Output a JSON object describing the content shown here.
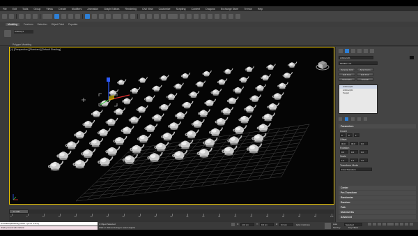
{
  "menubar": {
    "items": [
      "File",
      "Edit",
      "Tools",
      "Group",
      "Views",
      "Create",
      "Modifiers",
      "Animation",
      "Graph Editors",
      "Rendering",
      "Civil View",
      "Customize",
      "Scripting",
      "Content",
      "Dragons",
      "Exchange Store",
      "Tremor",
      "Help"
    ]
  },
  "ribbon": {
    "tabs": [
      "Modeling",
      "Freeform",
      "Selection",
      "Object Paint",
      "Populate"
    ],
    "active_tab": "Modeling",
    "panel_label": "Polygon Modeling",
    "object_name": "Arbitrary1"
  },
  "viewport": {
    "label": "[+] [Perspective] [Standard] [Default Shading]",
    "teapot_rows": 9,
    "teapot_cols": 9
  },
  "command_panel": {
    "object_name": "Arbitrary01",
    "modifier_list": "Modifier List",
    "buttons": [
      "Arrange Grid",
      "Array Form",
      "Edit Poly",
      "Edit Poly",
      "Symmetry",
      "Smooth"
    ],
    "stack": [
      "Arbitrary01",
      "Arbitrary01",
      "Teapot"
    ],
    "section_title": "Parameters",
    "count_label": "Count",
    "count_values": [
      "9",
      "9",
      "1"
    ],
    "offset_label": "Offset",
    "offset_values": [
      "30.0",
      "30.0",
      "0.0"
    ],
    "rotation_label": "Rotation",
    "rotation_values": [
      "0.0",
      "0.0",
      "0.0"
    ],
    "scale_label": "Scale",
    "scale_values": [
      "1.0",
      "1.0",
      "1.0"
    ],
    "transform_label": "Transform Mode",
    "transform_value": "Final Transform",
    "rollouts": [
      "Center",
      "Pre-Transform",
      "Randomize",
      "Random",
      "Path",
      "Material IDs",
      "Advanced"
    ]
  },
  "timeline": {
    "frame_readout": "0 / 100",
    "ticks": [
      "0",
      "5",
      "10",
      "15",
      "20",
      "25",
      "30",
      "35",
      "40",
      "45",
      "50",
      "55",
      "60",
      "65",
      "70",
      "75",
      "80",
      "85",
      "90",
      "95",
      "100"
    ]
  },
  "status": {
    "script_line1": "$.modifiers[#Arbitrary].offset = [1.1 0 -174.2]",
    "script_line2": "shade pos and add cellural",
    "selected": "1 Object Selected",
    "hint": "Click or click-and-drag to select objects",
    "x_label": "X:",
    "x_value": "-0.0 cm",
    "y_label": "Y:",
    "y_value": "0.0 cm",
    "z_label": "Z:",
    "z_value": "0.0 cm",
    "grid": "Grid = 10.0 cm",
    "auto_label": "Auto",
    "set_key_label": "Set Key",
    "selected_dropdown": "Selected",
    "key_filters": "Key Filters..."
  },
  "colors": {
    "viewport_border": "#e8c200",
    "accent_blue": "#2d7fd6"
  }
}
